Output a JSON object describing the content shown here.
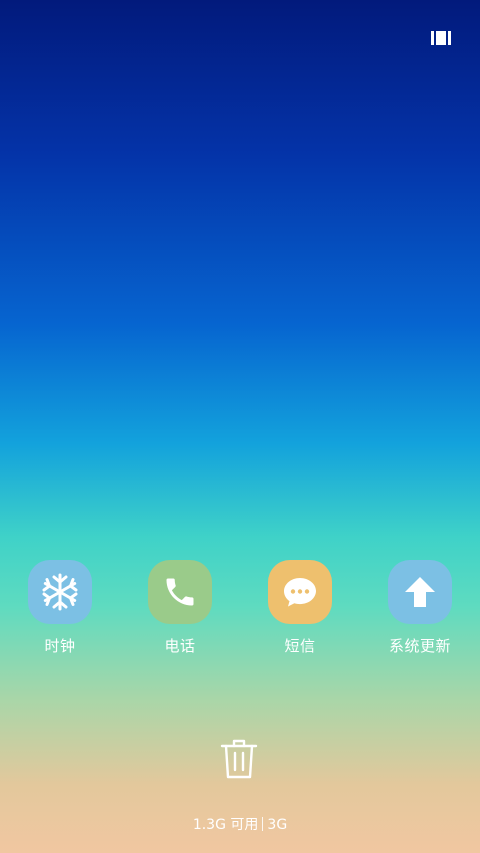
{
  "apps": [
    {
      "label": "时钟",
      "icon": "snowflake-icon",
      "color": "#7cc0e4"
    },
    {
      "label": "电话",
      "icon": "phone-icon",
      "color": "#9acb8a"
    },
    {
      "label": "短信",
      "icon": "message-bubble-icon",
      "color": "#eec06e"
    },
    {
      "label": "系统更新",
      "icon": "up-arrow-icon",
      "color": "#7cc0e4"
    }
  ],
  "memory": {
    "available": "1.3G 可用",
    "total": "3G"
  },
  "colors": {
    "gradient_top": "#021a7c",
    "gradient_mid": "#3fd2c8",
    "gradient_bottom": "#f1c7a1"
  }
}
